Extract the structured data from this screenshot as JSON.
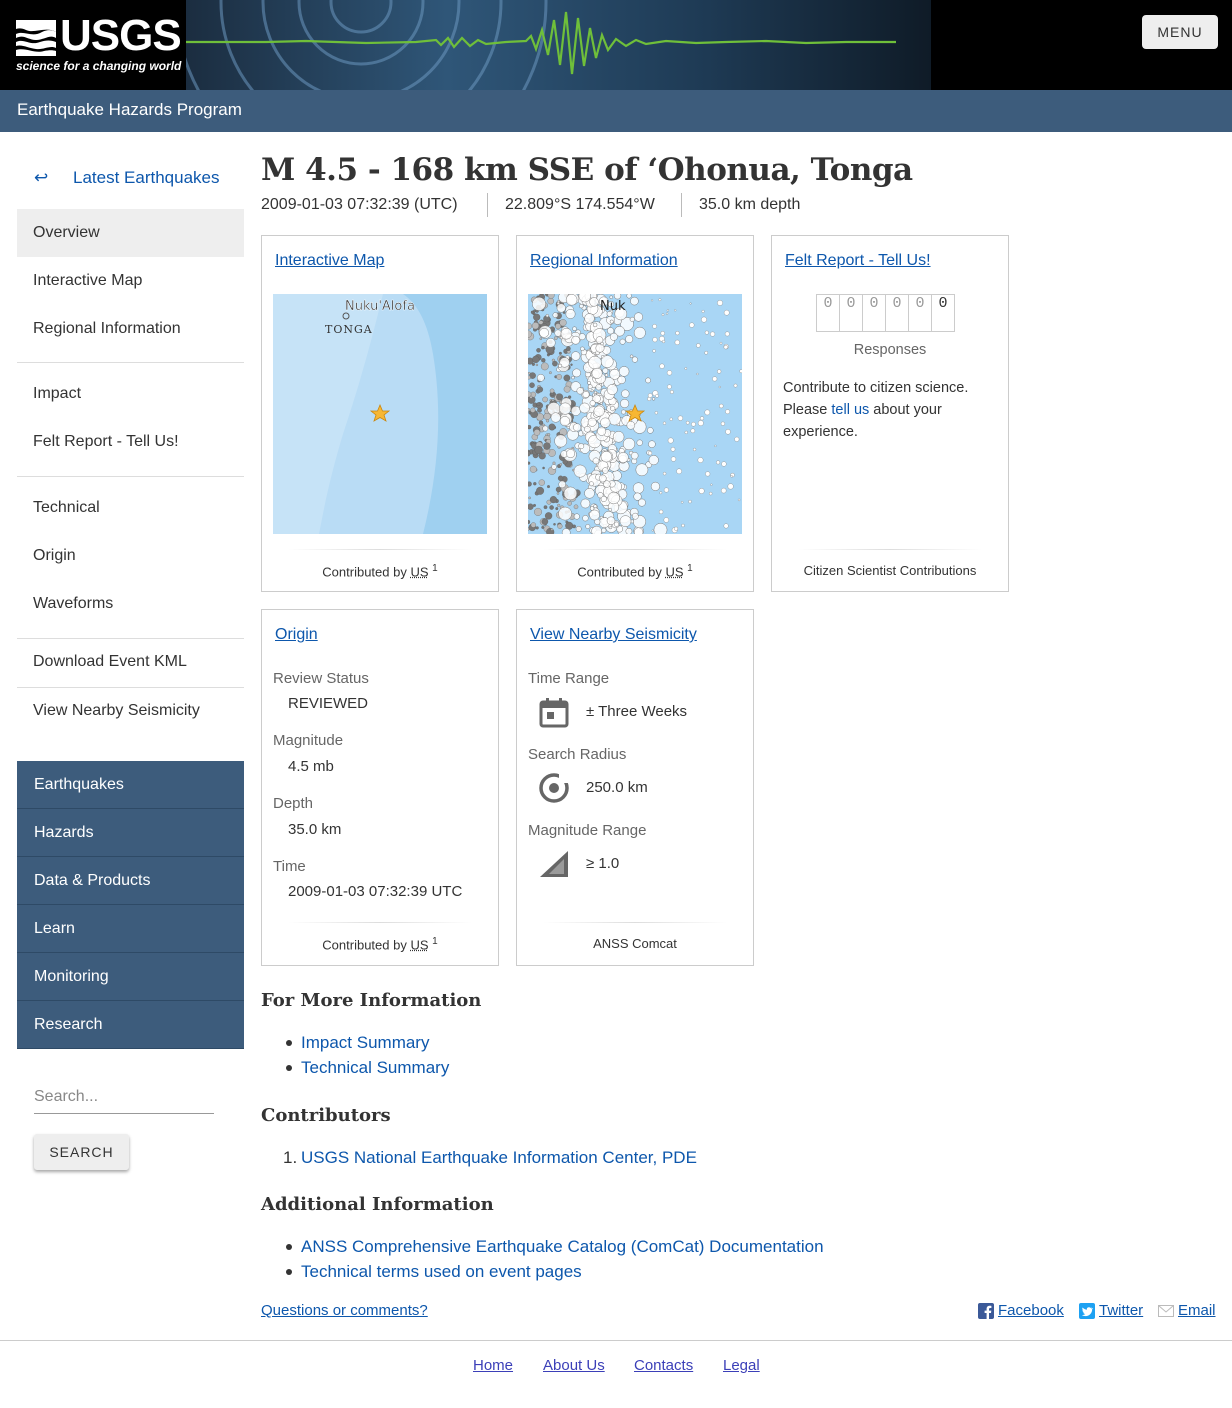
{
  "header": {
    "logo_text": "USGS",
    "logo_tagline": "science for a changing world",
    "menu_label": "MENU",
    "program_title": "Earthquake Hazards Program"
  },
  "sidebar": {
    "back_label": "Latest Earthquakes",
    "items": [
      {
        "label": "Overview"
      },
      {
        "label": "Interactive Map"
      },
      {
        "label": "Regional Information"
      },
      {
        "label": "Impact"
      },
      {
        "label": "Felt Report - Tell Us!"
      },
      {
        "label": "Technical"
      },
      {
        "label": "Origin"
      },
      {
        "label": "Waveforms"
      },
      {
        "label": "Download Event KML"
      },
      {
        "label": "View Nearby Seismicity"
      }
    ],
    "site_nav": [
      "Earthquakes",
      "Hazards",
      "Data & Products",
      "Learn",
      "Monitoring",
      "Research"
    ],
    "search_placeholder": "Search...",
    "search_button": "SEARCH"
  },
  "event": {
    "title": "M 4.5 - 168 km SSE of ‘Ohonua, Tonga",
    "time": "2009-01-03 07:32:39 (UTC)",
    "location": "22.809°S 174.554°W",
    "depth": "35.0 km depth"
  },
  "cards": {
    "interactive_map": {
      "title": "Interactive Map",
      "map_labels": [
        "Nuku'Alofa",
        "TONGA"
      ],
      "foot_prefix": "Contributed by",
      "foot_source": "US",
      "foot_sup": "1"
    },
    "regional": {
      "title": "Regional Information",
      "map_labels": [
        "Nuk"
      ],
      "foot_prefix": "Contributed by",
      "foot_source": "US",
      "foot_sup": "1"
    },
    "felt": {
      "title": "Felt Report - Tell Us!",
      "counter": [
        "0",
        "0",
        "0",
        "0",
        "0",
        "0"
      ],
      "responses_label": "Responses",
      "text_before": "Contribute to citizen science. Please ",
      "link_text": "tell us",
      "text_after": " about your experience.",
      "foot": "Citizen Scientist Contributions"
    },
    "origin": {
      "title": "Origin",
      "review_label": "Review Status",
      "review_value": "REVIEWED",
      "magnitude_label": "Magnitude",
      "magnitude_value": "4.5 mb",
      "depth_label": "Depth",
      "depth_value": "35.0 km",
      "time_label": "Time",
      "time_value": "2009-01-03 07:32:39 UTC",
      "foot_prefix": "Contributed by",
      "foot_source": "US",
      "foot_sup": "1"
    },
    "seismicity": {
      "title": "View Nearby Seismicity",
      "time_label": "Time Range",
      "time_value": "± Three Weeks",
      "radius_label": "Search Radius",
      "radius_value": "250.0 km",
      "magnitude_label": "Magnitude Range",
      "magnitude_value": "≥ 1.0",
      "foot": "ANSS Comcat",
      "icons": [
        "calendar-icon",
        "target-icon",
        "magnitude-range-icon"
      ]
    }
  },
  "more_info": {
    "heading": "For More Information",
    "links": [
      "Impact Summary",
      "Technical Summary"
    ]
  },
  "contributors": {
    "heading": "Contributors",
    "items": [
      {
        "num": "1.",
        "label": "USGS National Earthquake Information Center, PDE"
      }
    ]
  },
  "additional": {
    "heading": "Additional Information",
    "links": [
      "ANSS Comprehensive Earthquake Catalog (ComCat) Documentation",
      "Technical terms used on event pages"
    ]
  },
  "feedback": {
    "questions": "Questions or comments?",
    "share": [
      "Facebook",
      "Twitter",
      "Email"
    ]
  },
  "footer": {
    "links": [
      "Home",
      "About Us",
      "Contacts",
      "Legal"
    ]
  },
  "colors": {
    "program_bar": "#3d5c7c",
    "link": "#0d57ac",
    "footer_link": "#3b3fb8",
    "map_water": "#b9dcf5"
  }
}
